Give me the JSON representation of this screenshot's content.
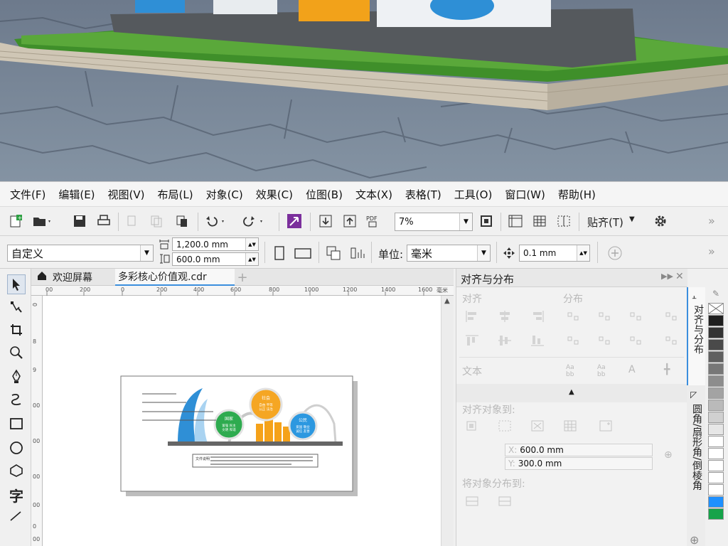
{
  "menu": [
    "文件(F)",
    "编辑(E)",
    "视图(V)",
    "布局(L)",
    "对象(C)",
    "效果(C)",
    "位图(B)",
    "文本(X)",
    "表格(T)",
    "工具(O)",
    "窗口(W)",
    "帮助(H)"
  ],
  "toolbar1": {
    "zoom": "7%",
    "snap_label": "贴齐(T)"
  },
  "toolbar2": {
    "page_preset": "自定义",
    "width": "1,200.0 mm",
    "height": "600.0 mm",
    "units_label": "单位:",
    "units_value": "毫米",
    "nudge": "0.1 mm"
  },
  "tabs": {
    "welcome": "欢迎屏幕",
    "document": "多彩核心价值观.cdr"
  },
  "ruler_h": [
    "00",
    "200",
    "0",
    "200",
    "400",
    "600",
    "800",
    "1000",
    "1200",
    "1400",
    "1600"
  ],
  "ruler_v": [
    "0",
    "8",
    "9",
    "00",
    "00",
    "00",
    "00",
    "0",
    "00"
  ],
  "ruler_unit": "毫米",
  "docker": {
    "title": "对齐与分布",
    "align_label": "对齐",
    "distribute_label": "分布",
    "text_label": "文本",
    "align_to_label": "对齐对象到:",
    "x_value": "600.0 mm",
    "y_value": "300.0 mm",
    "distribute_to_label": "将对象分布到:"
  },
  "side_tabs": [
    "对齐与分布",
    "圆角/扇形角/倒棱角"
  ],
  "artwork": {
    "circle1_title": "国家",
    "circle1_lines": [
      "富强 民主",
      "文明 和谐"
    ],
    "circle2_title": "社会",
    "circle2_lines": [
      "自由 平等",
      "公正 法治"
    ],
    "circle3_title": "公民",
    "circle3_lines": [
      "爱国 敬业",
      "诚信 友善"
    ],
    "plaque_label": "文件说明"
  },
  "palette": [
    "#ffffff",
    "#1f1f1f",
    "#333333",
    "#4a4a4a",
    "#606060",
    "#777777",
    "#8d8d8d",
    "#a3a3a3",
    "#bababa",
    "#d0d0d0",
    "#e6e6e6",
    "#ffffff",
    "#1e90ff",
    "#16a34a"
  ]
}
